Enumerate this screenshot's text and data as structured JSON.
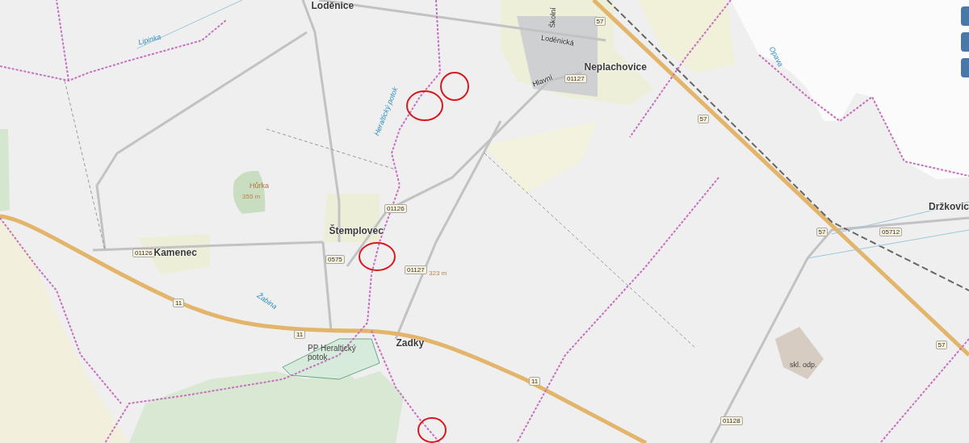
{
  "map": {
    "labels": [
      {
        "kind": "settlement",
        "text": "Loděnice"
      },
      {
        "kind": "water",
        "text": "Lipinka"
      },
      {
        "kind": "water",
        "text": "Heraltický potok"
      },
      {
        "kind": "peak",
        "text": "Hůrka"
      },
      {
        "kind": "elevation",
        "text": "355 m"
      },
      {
        "kind": "road_number",
        "text": "01126"
      },
      {
        "kind": "settlement",
        "text": "Štemplovec"
      },
      {
        "kind": "road_number",
        "text": "01126"
      },
      {
        "kind": "settlement",
        "text": "Kamenec"
      },
      {
        "kind": "road_number",
        "text": "0575"
      },
      {
        "kind": "road_number",
        "text": "01127"
      },
      {
        "kind": "elevation",
        "text": "323 m"
      },
      {
        "kind": "water",
        "text": "Žabina"
      },
      {
        "kind": "road_number",
        "text": "11"
      },
      {
        "kind": "road_number",
        "text": "11"
      },
      {
        "kind": "area",
        "text": "PP Heraltický potok"
      },
      {
        "kind": "settlement",
        "text": "Zadky"
      },
      {
        "kind": "road_number",
        "text": "11"
      },
      {
        "kind": "settlement",
        "text": "Neplachovice"
      },
      {
        "kind": "street",
        "text": "Školní"
      },
      {
        "kind": "street",
        "text": "Loděnická"
      },
      {
        "kind": "street",
        "text": "Hlavní"
      },
      {
        "kind": "road_number",
        "text": "01127"
      },
      {
        "kind": "road_number",
        "text": "57"
      },
      {
        "kind": "road_number",
        "text": "57"
      },
      {
        "kind": "water",
        "text": "Opava"
      },
      {
        "kind": "settlement",
        "text": "Držkovic"
      },
      {
        "kind": "road_number",
        "text": "57"
      },
      {
        "kind": "road_number",
        "text": "05712"
      },
      {
        "kind": "road_number",
        "text": "57"
      },
      {
        "kind": "landuse",
        "text": "skl. odp."
      },
      {
        "kind": "road_number",
        "text": "01128"
      }
    ]
  }
}
